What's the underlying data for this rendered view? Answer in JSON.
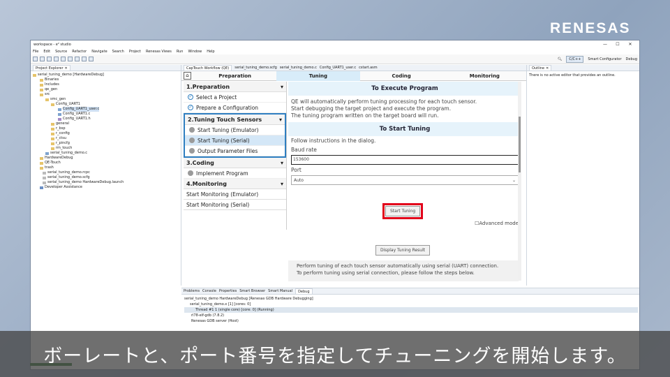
{
  "brand": "RENESAS",
  "window": {
    "title": "workspace - e² studio",
    "controls": [
      "—",
      "☐",
      "✕"
    ]
  },
  "menu": [
    "File",
    "Edit",
    "Source",
    "Refactor",
    "Navigate",
    "Search",
    "Project",
    "Renesas Views",
    "Run",
    "Window",
    "Help"
  ],
  "toolbar_right": {
    "perspective": "C/C++",
    "smart_configurator": "Smart Configurator",
    "debug": "Debug"
  },
  "explorer": {
    "tab": "Project Explorer",
    "items": [
      "serial_tuning_demo [HardwareDebug]",
      "Binaries",
      "Includes",
      "qe_gen",
      "src",
      "smc_gen",
      "Config_UART1",
      "Config_UART1_user.c",
      "Config_UART1.c",
      "Config_UART1.h",
      "general",
      "r_bsp",
      "r_config",
      "r_ctsu",
      "r_pincfg",
      "rm_touch",
      "serial_tuning_demo.c",
      "HardwareDebug",
      "QE-Touch",
      "trash",
      "serial_tuning_demo.rcpc",
      "serial_tuning_demo.scfg",
      "serial_tuning_demo HardwareDebug.launch",
      "Developer Assistance"
    ]
  },
  "editor_tabs": [
    "CapTouch Workflow (QE)",
    "serial_tuning_demo.scfg",
    "serial_tuning_demo.c",
    "Config_UART1_user.c",
    "cstart.asm"
  ],
  "workflow": {
    "steps": [
      "Preparation",
      "Tuning",
      "Coding",
      "Monitoring"
    ]
  },
  "sections": {
    "prep": "1.Preparation",
    "prep_items": [
      "Select a Project",
      "Prepare a Configuration"
    ],
    "tuning": "2.Tuning Touch Sensors",
    "tuning_items": [
      "Start Tuning (Emulator)",
      "Start Tuning (Serial)",
      "Output Parameter Files"
    ],
    "coding": "3.Coding",
    "coding_items": [
      "Implement Program"
    ],
    "monitoring": "4.Monitoring",
    "monitoring_items": [
      "Start Monitoring (Emulator)",
      "Start Monitoring (Serial)"
    ]
  },
  "content": {
    "exec_title": "To Execute Program",
    "exec_text1": "QE will automatically perform tuning processing for each touch sensor.",
    "exec_text2": "Start debugging the target project and execute the program.",
    "exec_text3": "The tuning program written on the target board will run.",
    "tune_title": "To Start Tuning",
    "tune_text": "Follow instructions in the dialog.",
    "baud_label": "Baud rate",
    "baud_value": "153600",
    "port_label": "Port",
    "port_value": "Auto",
    "start_button": "Start Tuning",
    "advanced": "Advanced mode",
    "display_button": "Display Tuning Result",
    "footer1": "Perform tuning of each touch sensor automatically using serial (UART) connection.",
    "footer2": "To perform tuning using serial connection, please follow the steps below."
  },
  "outline": {
    "tab": "Outline",
    "message": "There is no active editor that provides an outline."
  },
  "bottom": {
    "tabs": [
      "Problems",
      "Console",
      "Properties",
      "Smart Browser",
      "Smart Manual",
      "Debug"
    ],
    "rows": [
      "serial_tuning_demo HardwareDebug [Renesas GDB Hardware Debugging]",
      "serial_tuning_demo.x [1] [cores: 0]",
      "Thread #1 1 (single core) [core: 0] (Running)",
      "rl78-elf-gdb (7.8.2)",
      "Renesas GDB server (Host)"
    ]
  },
  "subtitle": "ボーレートと、ポート番号を指定してチューニングを開始します。"
}
